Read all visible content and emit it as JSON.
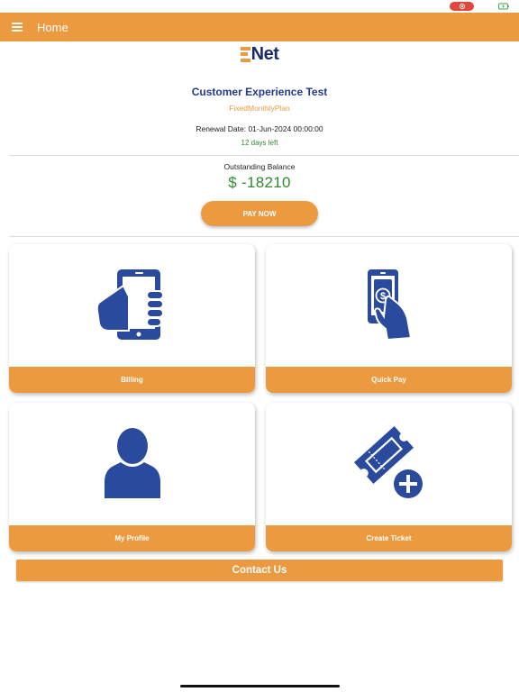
{
  "colors": {
    "accent": "#ec9a40",
    "brand_blue": "#233a8c",
    "icon_blue": "#2a4a9e",
    "positive_green": "#2e8b2e"
  },
  "header": {
    "title": "Home",
    "menu_icon": "hamburger-menu-icon"
  },
  "logo": {
    "text": "Net",
    "mark_icon": "enet-e-mark"
  },
  "account": {
    "customer_name": "Customer Experience Test",
    "plan": "FixedMonthlyPlan",
    "renewal_text": "Renewal Date: 01-Jun-2024 00:00:00",
    "days_left": "12 days left",
    "balance_label": "Outstanding Balance",
    "balance_value": "$ -18210",
    "pay_now_label": "PAY NOW"
  },
  "tiles": [
    {
      "label": "Billing",
      "icon": "hand-holding-phone-icon"
    },
    {
      "label": "Quick Pay",
      "icon": "hand-holding-money-phone-icon"
    },
    {
      "label": "My Profile",
      "icon": "user-silhouette-icon"
    },
    {
      "label": "Create Ticket",
      "icon": "ticket-plus-icon"
    }
  ],
  "contact_label": "Contact Us"
}
